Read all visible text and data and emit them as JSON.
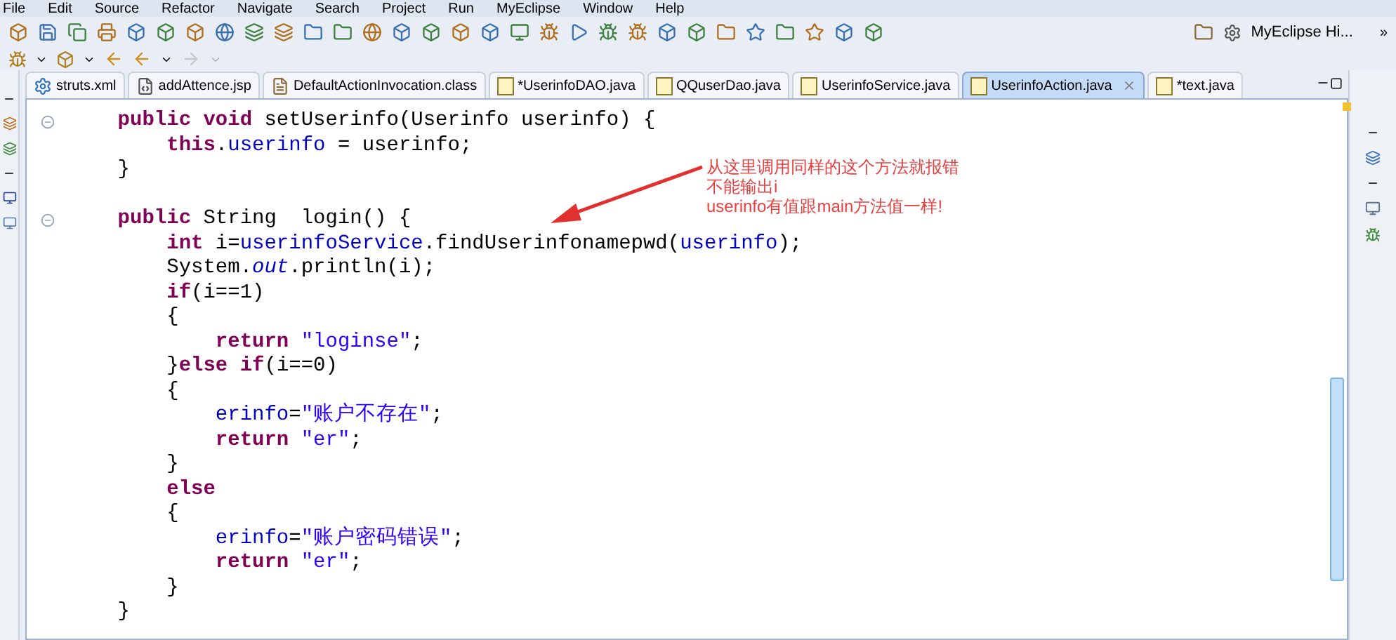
{
  "menu_bar": [
    "File",
    "Edit",
    "Source",
    "Refactor",
    "Navigate",
    "Search",
    "Project",
    "Run",
    "MyEclipse",
    "Window",
    "Help"
  ],
  "perspective": {
    "label": "MyEclipse Hi...",
    "overflow": "»"
  },
  "tabs": [
    {
      "label": "struts.xml",
      "kind": "xml",
      "selected": false
    },
    {
      "label": "addAttence.jsp",
      "kind": "jsp",
      "selected": false
    },
    {
      "label": "DefaultActionInvocation.class",
      "kind": "class",
      "selected": false
    },
    {
      "label": "*UserinfoDAO.java",
      "kind": "java",
      "selected": false
    },
    {
      "label": "QQuserDao.java",
      "kind": "java",
      "selected": false
    },
    {
      "label": "UserinfoService.java",
      "kind": "java",
      "selected": false
    },
    {
      "label": "UserinfoAction.java",
      "kind": "java",
      "selected": true
    },
    {
      "label": "*text.java",
      "kind": "java",
      "selected": false
    }
  ],
  "code_lines": [
    {
      "fold": true,
      "tokens": [
        {
          "kind": "keyword",
          "text": "    public void"
        },
        {
          "kind": "plain",
          "text": " setUserinfo(Userinfo userinfo) {"
        }
      ]
    },
    {
      "fold": false,
      "tokens": [
        {
          "kind": "keyword",
          "text": "        this"
        },
        {
          "kind": "plain",
          "text": "."
        },
        {
          "kind": "field",
          "text": "userinfo"
        },
        {
          "kind": "plain",
          "text": " = userinfo;"
        }
      ]
    },
    {
      "fold": false,
      "tokens": [
        {
          "kind": "plain",
          "text": "    }"
        }
      ]
    },
    {
      "fold": false
    },
    {
      "fold": true,
      "tokens": [
        {
          "kind": "keyword",
          "text": "    public"
        },
        {
          "kind": "plain",
          "text": " String  login() {"
        }
      ]
    },
    {
      "fold": false,
      "tokens": [
        {
          "kind": "keyword",
          "text": "        int"
        },
        {
          "kind": "plain",
          "text": " i="
        },
        {
          "kind": "field",
          "text": "userinfoService"
        },
        {
          "kind": "plain",
          "text": ".findUserinfonamepwd("
        },
        {
          "kind": "field",
          "text": "userinfo"
        },
        {
          "kind": "plain",
          "text": ");"
        }
      ]
    },
    {
      "fold": false,
      "tokens": [
        {
          "kind": "plain",
          "text": "        System."
        },
        {
          "kind": "static",
          "text": "out"
        },
        {
          "kind": "plain",
          "text": ".println(i);"
        }
      ]
    },
    {
      "fold": false,
      "tokens": [
        {
          "kind": "keyword",
          "text": "        if"
        },
        {
          "kind": "plain",
          "text": "(i==1)"
        }
      ]
    },
    {
      "fold": false,
      "tokens": [
        {
          "kind": "plain",
          "text": "        {"
        }
      ]
    },
    {
      "fold": false,
      "tokens": [
        {
          "kind": "keyword",
          "text": "            return"
        },
        {
          "kind": "string",
          "text": " \"loginse\""
        },
        {
          "kind": "plain",
          "text": ";"
        }
      ]
    },
    {
      "fold": false,
      "tokens": [
        {
          "kind": "plain",
          "text": "        }"
        },
        {
          "kind": "keyword",
          "text": "else if"
        },
        {
          "kind": "plain",
          "text": "(i==0)"
        }
      ]
    },
    {
      "fold": false,
      "tokens": [
        {
          "kind": "plain",
          "text": "        {"
        }
      ]
    },
    {
      "fold": false,
      "tokens": [
        {
          "kind": "field",
          "text": "            erinfo"
        },
        {
          "kind": "plain",
          "text": "="
        },
        {
          "kind": "string",
          "text": "\"账户不存在\""
        },
        {
          "kind": "plain",
          "text": ";"
        }
      ]
    },
    {
      "fold": false,
      "tokens": [
        {
          "kind": "keyword",
          "text": "            return"
        },
        {
          "kind": "string",
          "text": " \"er\""
        },
        {
          "kind": "plain",
          "text": ";"
        }
      ]
    },
    {
      "fold": false,
      "tokens": [
        {
          "kind": "plain",
          "text": "        }"
        }
      ]
    },
    {
      "fold": false,
      "tokens": [
        {
          "kind": "keyword",
          "text": "        else"
        }
      ]
    },
    {
      "fold": false,
      "tokens": [
        {
          "kind": "plain",
          "text": "        {"
        }
      ]
    },
    {
      "fold": false,
      "tokens": [
        {
          "kind": "field",
          "text": "            erinfo"
        },
        {
          "kind": "plain",
          "text": "="
        },
        {
          "kind": "string",
          "text": "\"账户密码错误\""
        },
        {
          "kind": "plain",
          "text": ";"
        }
      ]
    },
    {
      "fold": false,
      "tokens": [
        {
          "kind": "keyword",
          "text": "            return"
        },
        {
          "kind": "string",
          "text": " \"er\""
        },
        {
          "kind": "plain",
          "text": ";"
        }
      ]
    },
    {
      "fold": false,
      "tokens": [
        {
          "kind": "plain",
          "text": "        }"
        }
      ]
    },
    {
      "fold": false,
      "tokens": [
        {
          "kind": "plain",
          "text": "    }"
        }
      ]
    }
  ],
  "annotation": {
    "lines": [
      "从这里调用同样的这个方法就报错",
      "不能输出i",
      "userinfo有值跟main方法值一样!"
    ]
  }
}
